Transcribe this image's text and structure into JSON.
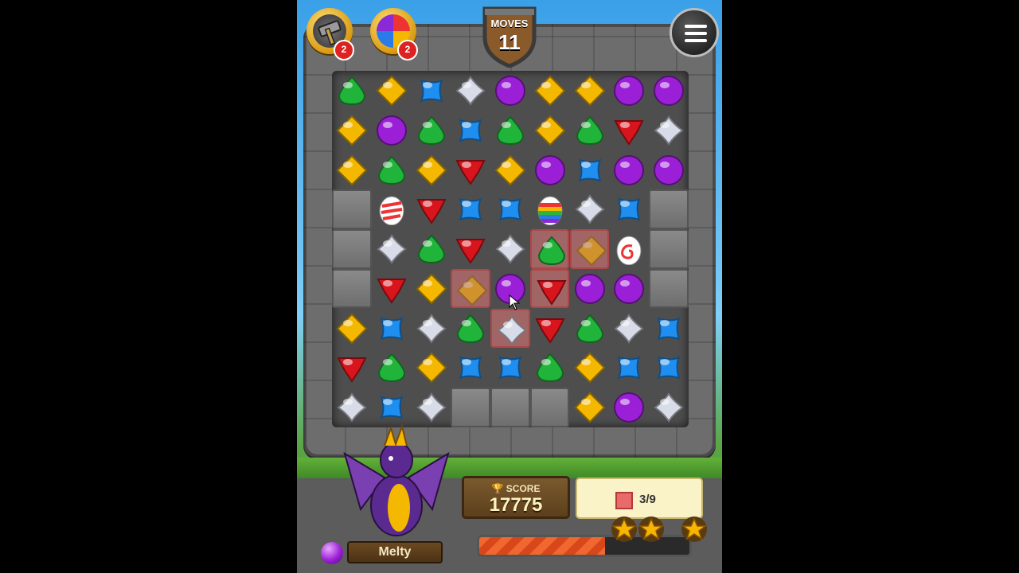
{
  "moves": {
    "label": "MOVES",
    "value": "11"
  },
  "powerups": [
    {
      "name": "hammer",
      "count": "2",
      "icon": "hammer-icon"
    },
    {
      "name": "magic-ball",
      "count": "2",
      "icon": "magic-ball-icon"
    }
  ],
  "score": {
    "label": "SCORE",
    "value": "17775"
  },
  "goal": {
    "count": "3/9",
    "icon": "red-tile-icon"
  },
  "progress": {
    "fraction": 0.6
  },
  "stars": [
    {
      "filled": true
    },
    {
      "filled": true
    },
    {
      "filled": true
    }
  ],
  "character": {
    "name": "Melty",
    "orb_color": "#9b1fd6"
  },
  "colors": {
    "green": "#20b53a",
    "yellow": "#f5b800",
    "blue": "#1e8ef0",
    "white": "#d8dce8",
    "purple": "#9b1fd6",
    "red": "#d8141c"
  },
  "board": {
    "rows": 9,
    "cols": 9,
    "grid": [
      [
        "green",
        "yellow",
        "blue",
        "white",
        "purple",
        "yellow",
        "yellow",
        "purple",
        "purple"
      ],
      [
        "yellow",
        "purple",
        "green",
        "blue",
        "green",
        "yellow",
        "green",
        "red",
        "white"
      ],
      [
        "yellow",
        "green",
        "yellow",
        "red",
        "yellow",
        "purple",
        "blue",
        "purple",
        "purple"
      ],
      [
        "stone",
        "egg-red",
        "red",
        "blue",
        "blue",
        "egg-rainbow",
        "white",
        "blue",
        "stone"
      ],
      [
        "stone",
        "white",
        "green",
        "red",
        "white",
        "green",
        "yellow",
        "egg-swirl",
        "stone"
      ],
      [
        "stone",
        "red",
        "yellow",
        "yellow",
        "purple",
        "red",
        "purple",
        "purple",
        "stone"
      ],
      [
        "yellow",
        "blue",
        "white",
        "green",
        "white",
        "red",
        "green",
        "white",
        "blue"
      ],
      [
        "red",
        "green",
        "yellow",
        "blue",
        "blue",
        "green",
        "yellow",
        "blue",
        "blue"
      ],
      [
        "white",
        "blue",
        "white",
        "stone",
        "stone",
        "stone",
        "yellow",
        "purple",
        "white"
      ]
    ],
    "locked": [
      [
        4,
        5
      ],
      [
        4,
        6
      ],
      [
        5,
        3
      ],
      [
        5,
        5
      ],
      [
        6,
        4
      ]
    ],
    "faded": [
      [
        4,
        6
      ],
      [
        5,
        3
      ]
    ]
  }
}
